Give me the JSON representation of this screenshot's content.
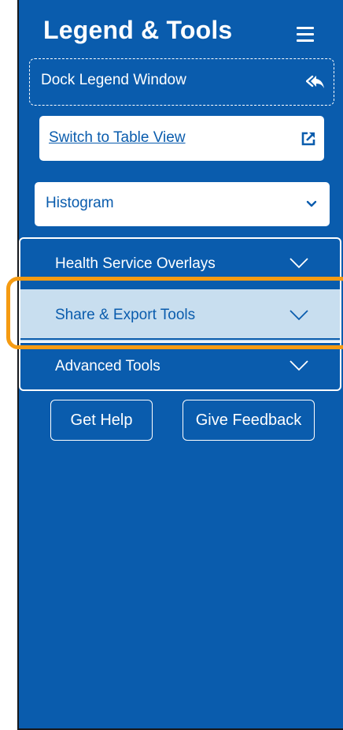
{
  "header": {
    "title": "Legend & Tools",
    "menu_icon": "hamburger-menu-icon"
  },
  "dock": {
    "label": "Dock Legend Window",
    "icon": "dock-arrow-icon"
  },
  "table_view": {
    "label": "Switch to Table View",
    "icon": "external-link-icon"
  },
  "chart_select": {
    "selected": "Histogram",
    "icon": "chevron-down-icon"
  },
  "accordion": {
    "items": [
      {
        "label": "Health Service Overlays",
        "expanded": false
      },
      {
        "label": "Share & Export Tools",
        "expanded": false,
        "highlighted": true
      },
      {
        "label": "Advanced Tools",
        "expanded": false
      }
    ]
  },
  "actions": {
    "help_label": "Get Help",
    "feedback_label": "Give Feedback"
  },
  "colors": {
    "panel_bg": "#0a5cad",
    "active_item_bg": "#c8deef",
    "highlight_outline": "#f59b12",
    "text_light": "#ffffff"
  }
}
